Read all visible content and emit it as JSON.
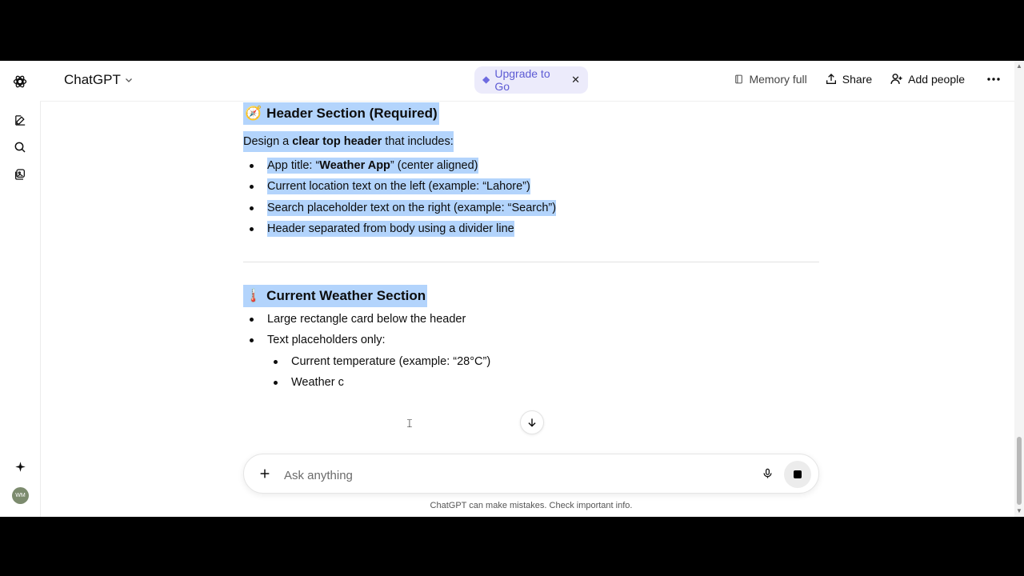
{
  "header": {
    "brand": "ChatGPT",
    "upgrade_label": "Upgrade to Go",
    "memory_label": "Memory full",
    "share_label": "Share",
    "add_people_label": "Add people"
  },
  "sidebar": {
    "icons": [
      "chatgpt-logo-icon",
      "new-chat-icon",
      "search-icon",
      "library-icon",
      "sparkle-icon"
    ],
    "avatar_initials": "WM"
  },
  "content": {
    "section1": {
      "emoji": "🧭",
      "title": "Header Section (Required)",
      "intro_pre": "Design a ",
      "intro_bold": "clear top header",
      "intro_post": " that includes:",
      "items": [
        {
          "pre": "App title: “",
          "bold": "Weather App",
          "post": "” (center aligned)"
        },
        {
          "text": "Current location text on the left (example: “Lahore”)"
        },
        {
          "text": "Search placeholder text on the right (example: “Search”)"
        },
        {
          "text": "Header separated from body using a divider line"
        }
      ]
    },
    "section2": {
      "emoji": "🌡️",
      "title": "Current Weather Section",
      "items": [
        "Large rectangle card below the header",
        "Text placeholders only:"
      ],
      "subitems": [
        "Current temperature (example: “28°C”)",
        "Weather c"
      ]
    }
  },
  "composer": {
    "placeholder": "Ask anything",
    "disclaimer": "ChatGPT can make mistakes. Check important info."
  }
}
